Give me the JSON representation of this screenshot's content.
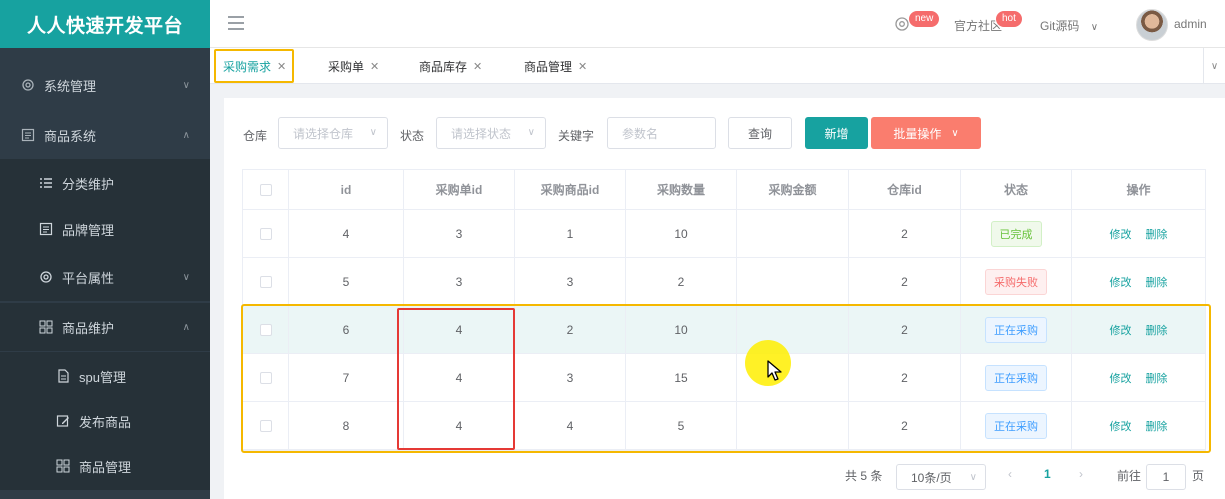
{
  "brand": "人人快速开发平台",
  "sidebar": {
    "items": [
      {
        "label": "系统管理"
      },
      {
        "label": "商品系统"
      },
      {
        "label": "分类维护"
      },
      {
        "label": "品牌管理"
      },
      {
        "label": "平台属性"
      },
      {
        "label": "商品维护"
      },
      {
        "label": "spu管理"
      },
      {
        "label": "发布商品"
      },
      {
        "label": "商品管理"
      }
    ]
  },
  "header": {
    "badge_new": "new",
    "community": "官方社区",
    "badge_hot": "hot",
    "git": "Git源码",
    "user": "admin"
  },
  "tabs": [
    {
      "label": "采购需求"
    },
    {
      "label": "采购单"
    },
    {
      "label": "商品库存"
    },
    {
      "label": "商品管理"
    }
  ],
  "filters": {
    "warehouse_label": "仓库",
    "warehouse_placeholder": "请选择仓库",
    "status_label": "状态",
    "status_placeholder": "请选择状态",
    "keyword_label": "关键字",
    "keyword_placeholder": "参数名",
    "query": "查询",
    "add": "新增",
    "batch": "批量操作"
  },
  "table": {
    "columns": [
      "id",
      "采购单id",
      "采购商品id",
      "采购数量",
      "采购金额",
      "仓库id",
      "状态",
      "操作"
    ],
    "edit": "修改",
    "delete": "删除",
    "rows": [
      {
        "id": "4",
        "order_id": "3",
        "sku_id": "1",
        "qty": "10",
        "amount": "",
        "ware_id": "2",
        "status": "已完成",
        "status_type": "success"
      },
      {
        "id": "5",
        "order_id": "3",
        "sku_id": "3",
        "qty": "2",
        "amount": "",
        "ware_id": "2",
        "status": "采购失败",
        "status_type": "danger"
      },
      {
        "id": "6",
        "order_id": "4",
        "sku_id": "2",
        "qty": "10",
        "amount": "",
        "ware_id": "2",
        "status": "正在采购",
        "status_type": "info"
      },
      {
        "id": "7",
        "order_id": "4",
        "sku_id": "3",
        "qty": "15",
        "amount": "",
        "ware_id": "2",
        "status": "正在采购",
        "status_type": "info"
      },
      {
        "id": "8",
        "order_id": "4",
        "sku_id": "4",
        "qty": "5",
        "amount": "",
        "ware_id": "2",
        "status": "正在采购",
        "status_type": "info"
      }
    ]
  },
  "pagination": {
    "total": "共 5 条",
    "page_size": "10条/页",
    "current": "1",
    "goto_label": "前往",
    "goto_value": "1",
    "page_unit": "页"
  }
}
